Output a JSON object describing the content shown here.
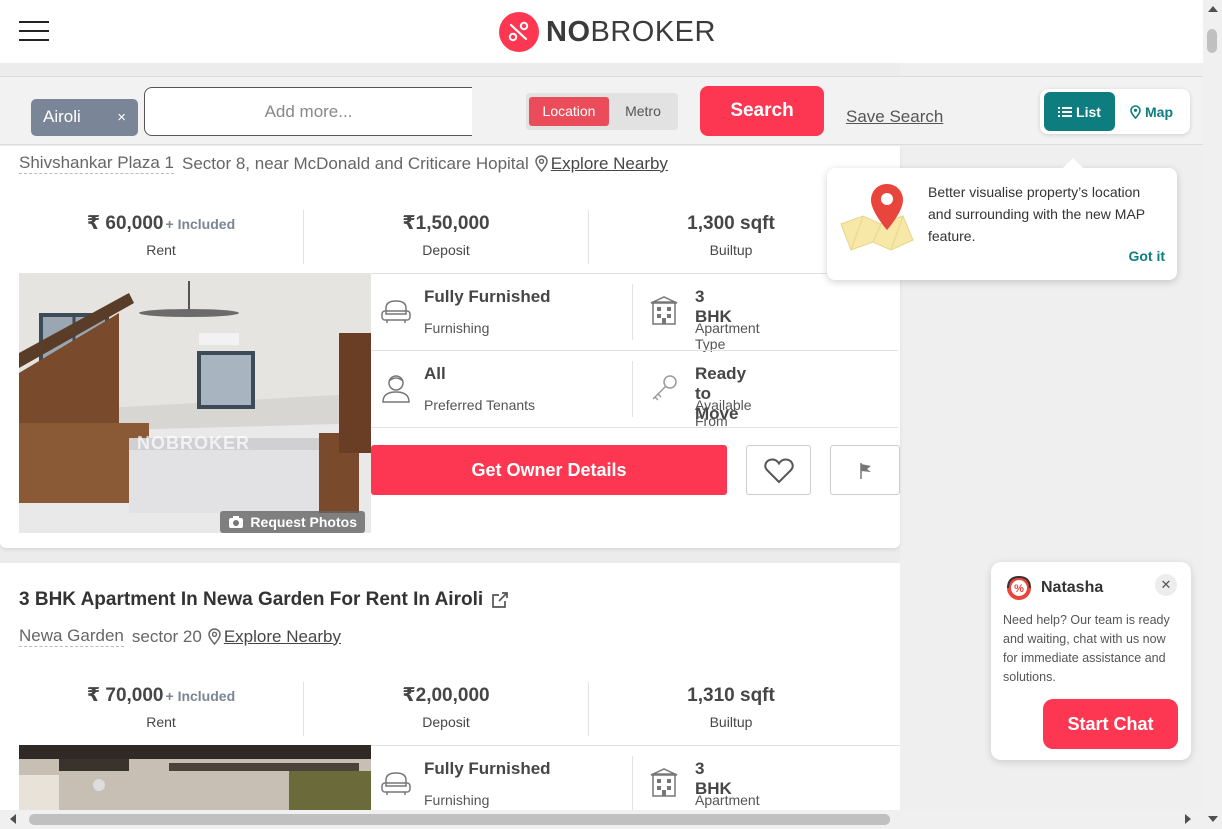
{
  "header": {
    "logo_text_bold": "NO",
    "logo_text_rest": "BROKER"
  },
  "search": {
    "chip_label": "Airoli",
    "chip_remove": "×",
    "placeholder": "Add more...",
    "mode_location": "Location",
    "mode_metro": "Metro",
    "search_button": "Search",
    "save_search": "Save Search",
    "view_list": "List",
    "view_map": "Map"
  },
  "listing1": {
    "building": "Shivshankar Plaza 1",
    "locality": "Sector 8, near McDonald and Criticare Hopital",
    "explore": "Explore Nearby",
    "rent_value": "₹ 60,000",
    "rent_included": "+ Included",
    "rent_label": "Rent",
    "deposit_value": "₹1,50,000",
    "deposit_label": "Deposit",
    "builtup_value": "1,300 sqft",
    "builtup_label": "Builtup",
    "furnishing_value": "Fully Furnished",
    "furnishing_label": "Furnishing",
    "apt_value": "3 BHK",
    "apt_label": "Apartment Type",
    "tenants_value": "All",
    "tenants_label": "Preferred Tenants",
    "available_value": "Ready to Move",
    "available_label": "Available From",
    "owner_button": "Get Owner Details",
    "photo_watermark": "NOBROKER",
    "request_photos": "Request Photos"
  },
  "listing2": {
    "title": "3 BHK Apartment In Newa Garden For Rent In Airoli",
    "building": "Newa Garden",
    "locality": "sector 20",
    "explore": "Explore Nearby",
    "rent_value": "₹ 70,000",
    "rent_included": "+ Included",
    "rent_label": "Rent",
    "deposit_value": "₹2,00,000",
    "deposit_label": "Deposit",
    "builtup_value": "1,310 sqft",
    "builtup_label": "Builtup",
    "furnishing_value": "Fully Furnished",
    "furnishing_label": "Furnishing",
    "apt_value": "3 BHK",
    "apt_label": "Apartment Type"
  },
  "map_popover": {
    "text": "Better visualise property’s location and surrounding with the new MAP feature.",
    "got_it": "Got it"
  },
  "chat": {
    "agent_name": "Natasha",
    "close": "✕",
    "message": "Need help? Our team is ready and waiting, chat with us now for immediate assistance and solutions.",
    "start_button": "Start Chat"
  },
  "colors": {
    "brand_red": "#fd3752",
    "teal": "#0e7d7f",
    "chip_grey": "#7a8597"
  }
}
